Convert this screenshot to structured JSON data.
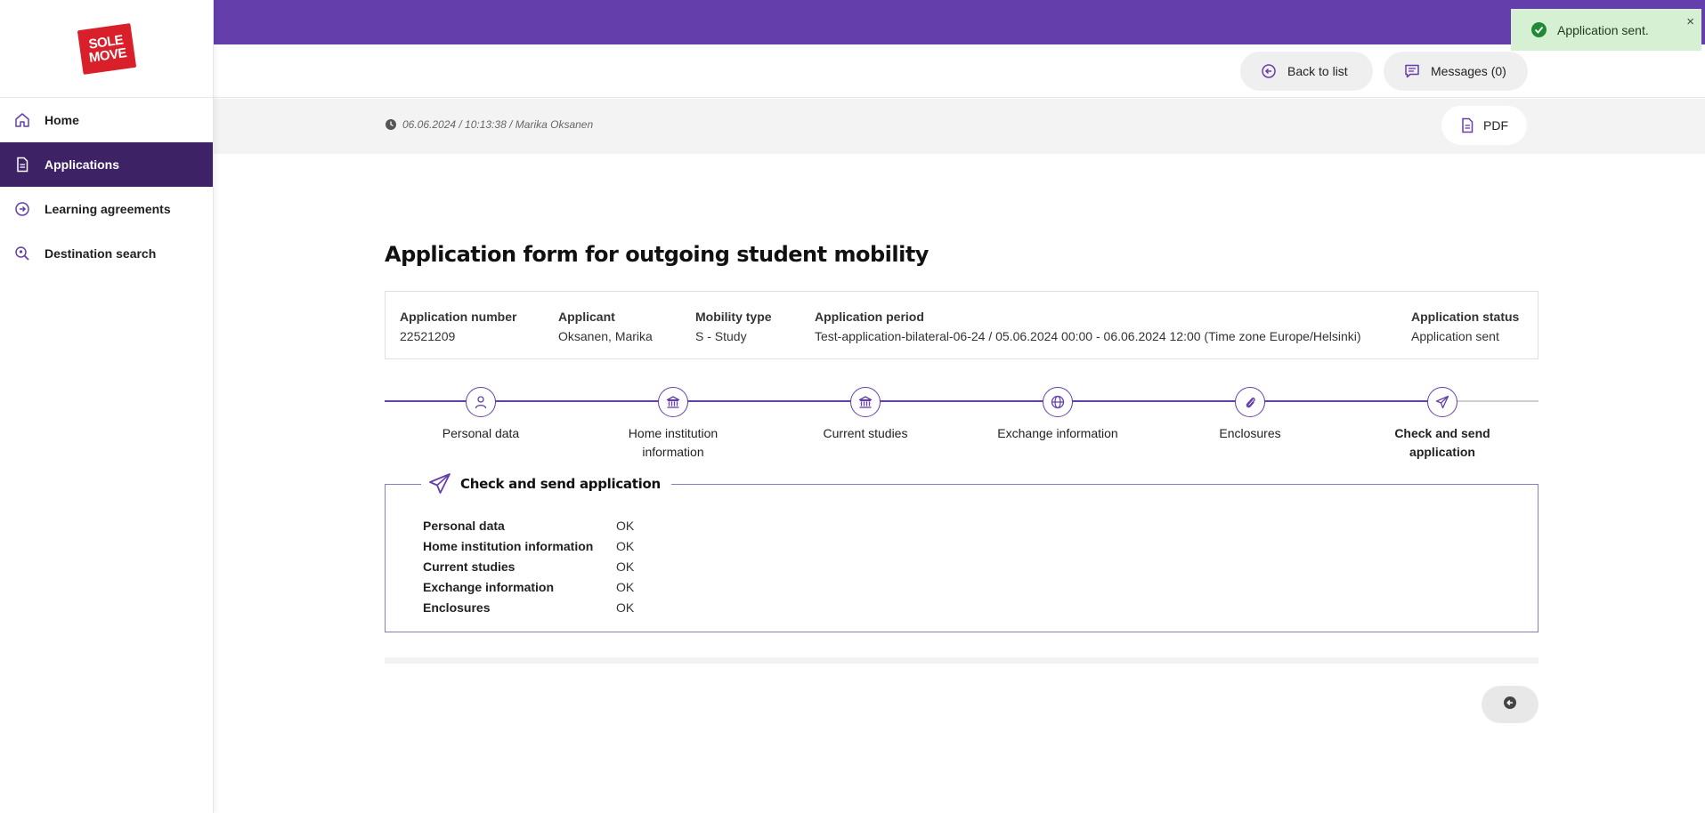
{
  "brand": {
    "logo_line1": "SOLE",
    "logo_line2": "MOVE"
  },
  "sidebar": {
    "items": [
      {
        "label": "Home",
        "icon": "home-icon"
      },
      {
        "label": "Applications",
        "icon": "document-icon",
        "active": true
      },
      {
        "label": "Learning agreements",
        "icon": "arrow-right-circle-icon"
      },
      {
        "label": "Destination search",
        "icon": "search-location-icon"
      }
    ]
  },
  "header": {
    "back_label": "Back to list",
    "messages_label": "Messages (0)"
  },
  "meta": {
    "text": "06.06.2024 /  10:13:38 /  Marika Oksanen",
    "pdf_label": "PDF"
  },
  "toast": {
    "message": "Application sent.",
    "close": "×"
  },
  "page": {
    "title": "Application form for outgoing student mobility"
  },
  "summary": {
    "application_number_label": "Application number",
    "application_number": "22521209",
    "applicant_label": "Applicant",
    "applicant": "Oksanen, Marika",
    "mobility_type_label": "Mobility type",
    "mobility_type": "S - Study",
    "application_period_label": "Application period",
    "application_period": "Test-application-bilateral-06-24 / 05.06.2024 00:00 - 06.06.2024 12:00 (Time zone Europe/Helsinki)",
    "application_status_label": "Application status",
    "application_status": "Application sent"
  },
  "steps": [
    {
      "label": "Personal data",
      "icon": "person-icon"
    },
    {
      "label": "Home institution information",
      "icon": "institution-icon"
    },
    {
      "label": "Current studies",
      "icon": "institution-icon"
    },
    {
      "label": "Exchange information",
      "icon": "globe-icon"
    },
    {
      "label": "Enclosures",
      "icon": "paperclip-icon"
    },
    {
      "label": "Check and send application",
      "icon": "send-icon",
      "current": true
    }
  ],
  "check": {
    "title": "Check and send application",
    "rows": [
      {
        "key": "Personal data",
        "value": "OK"
      },
      {
        "key": "Home institution information",
        "value": "OK"
      },
      {
        "key": "Current studies",
        "value": "OK"
      },
      {
        "key": "Exchange information",
        "value": "OK"
      },
      {
        "key": "Enclosures",
        "value": "OK"
      }
    ]
  },
  "colors": {
    "accent": "#643eab",
    "sidebar_active": "#3d2266",
    "toast_bg": "#d6f0d3",
    "toast_ok": "#208a35"
  }
}
